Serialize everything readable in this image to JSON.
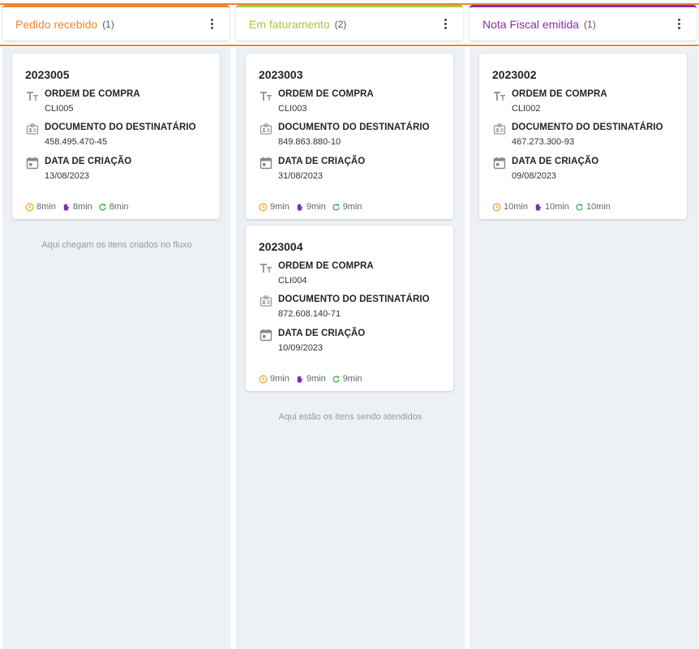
{
  "columns": [
    {
      "title": "Pedido recebido",
      "count": "(1)",
      "color": "#f2852b",
      "hint": "Aqui chegam os itens criados no fluxo",
      "cards": [
        {
          "code": "2023005",
          "fields": [
            {
              "label": "ORDEM DE COMPRA",
              "value": "CLI005"
            },
            {
              "label": "DOCUMENTO DO DESTINATÁRIO",
              "value": "458.495.470-45"
            },
            {
              "label": "DATA DE CRIAÇÃO",
              "value": "13/08/2023"
            }
          ],
          "timers": [
            "8min",
            "8min",
            "8min"
          ]
        }
      ]
    },
    {
      "title": "Em faturamento",
      "count": "(2)",
      "color": "#a6c93a",
      "hint": "Aqui estão os itens sendo atendidos",
      "cards": [
        {
          "code": "2023003",
          "fields": [
            {
              "label": "ORDEM DE COMPRA",
              "value": "CLI003"
            },
            {
              "label": "DOCUMENTO DO DESTINATÁRIO",
              "value": "849.863.880-10"
            },
            {
              "label": "DATA DE CRIAÇÃO",
              "value": "31/08/2023"
            }
          ],
          "timers": [
            "9min",
            "9min",
            "9min"
          ]
        },
        {
          "code": "2023004",
          "fields": [
            {
              "label": "ORDEM DE COMPRA",
              "value": "CLI004"
            },
            {
              "label": "DOCUMENTO DO DESTINATÁRIO",
              "value": "872.608.140-71"
            },
            {
              "label": "DATA DE CRIAÇÃO",
              "value": "10/09/2023"
            }
          ],
          "timers": [
            "9min",
            "9min",
            "9min"
          ]
        }
      ]
    },
    {
      "title": "Nota Fiscal emitida",
      "count": "(1)",
      "color": "#8a2fb0",
      "hint": "",
      "cards": [
        {
          "code": "2023002",
          "fields": [
            {
              "label": "ORDEM DE COMPRA",
              "value": "CLI002"
            },
            {
              "label": "DOCUMENTO DO DESTINATÁRIO",
              "value": "467.273.300-93"
            },
            {
              "label": "DATA DE CRIAÇÃO",
              "value": "09/08/2023"
            }
          ],
          "timers": [
            "10min",
            "10min",
            "10min"
          ]
        }
      ]
    }
  ],
  "icons": {
    "field_icons": [
      "text-format-icon",
      "id-card-icon",
      "calendar-icon"
    ],
    "timer_icons": [
      "clock-icon",
      "hand-icon",
      "refresh-icon"
    ],
    "timer_colors": [
      "#e8a21a",
      "#7a2fb0",
      "#3fae4a"
    ]
  }
}
